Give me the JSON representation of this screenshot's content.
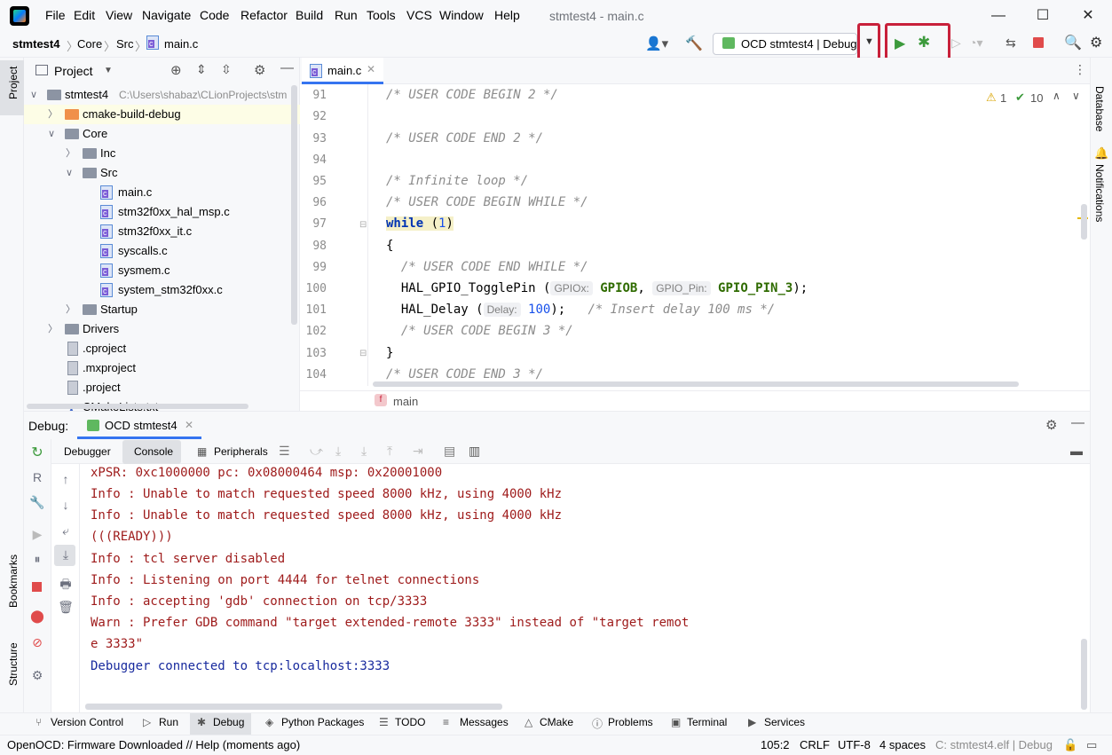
{
  "menu": [
    "File",
    "Edit",
    "View",
    "Navigate",
    "Code",
    "Refactor",
    "Build",
    "Run",
    "Tools",
    "VCS",
    "Window",
    "Help"
  ],
  "window_title": "stmtest4 - main.c",
  "window_buttons": {
    "minimize": "—",
    "maximize": "☐",
    "close": "✕"
  },
  "breadcrumb": [
    "stmtest4",
    "Core",
    "Src",
    "main.c"
  ],
  "run_config": "OCD stmtest4 | Debug",
  "project": {
    "title": "Project",
    "root_name": "stmtest4",
    "root_path": "C:\\Users\\shabaz\\CLionProjects\\stm",
    "items": [
      "cmake-build-debug",
      "Core",
      "Inc",
      "Src",
      "main.c",
      "stm32f0xx_hal_msp.c",
      "stm32f0xx_it.c",
      "syscalls.c",
      "sysmem.c",
      "system_stm32f0xx.c",
      "Startup",
      "Drivers",
      ".cproject",
      ".mxproject",
      ".project",
      "CMakeLists.txt"
    ]
  },
  "editor": {
    "tab": "main.c",
    "warnings": "1",
    "checks": "10",
    "line_numbers": [
      "91",
      "92",
      "93",
      "94",
      "95",
      "96",
      "97",
      "98",
      "99",
      "100",
      "101",
      "102",
      "103",
      "104"
    ],
    "lines": {
      "l91": "/* USER CODE BEGIN 2 */",
      "l93": "/* USER CODE END 2 */",
      "l95": "/* Infinite loop */",
      "l96": "/* USER CODE BEGIN WHILE */",
      "l97_kw": "while",
      "l97_rest": " (",
      "l97_num": "1",
      "l97_end": ")",
      "l98": "{",
      "l99": "  /* USER CODE END WHILE */",
      "l100_fn": "  HAL_GPIO_TogglePin (",
      "l100_hint1": "GPIOx:",
      "l100_arg1": "GPIOB",
      "l100_comma": ", ",
      "l100_hint2": "GPIO_Pin:",
      "l100_arg2": "GPIO_PIN_3",
      "l100_end": ");",
      "l101_fn": "  HAL_Delay (",
      "l101_hint": "Delay:",
      "l101_num": "100",
      "l101_end": ");   ",
      "l101_cm": "/* Insert delay 100 ms */",
      "l102": "  /* USER CODE BEGIN 3 */",
      "l103": "}",
      "l104": "/* USER CODE END 3 */"
    },
    "crumb": "main"
  },
  "debug": {
    "label": "Debug:",
    "session": "OCD stmtest4",
    "tabs": [
      "Debugger",
      "Console",
      "Peripherals"
    ],
    "console_lines": [
      "xPSR: 0xc1000000 pc: 0x08000464 msp: 0x20001000",
      "Info : Unable to match requested speed 8000 kHz, using 4000 kHz",
      "Info : Unable to match requested speed 8000 kHz, using 4000 kHz",
      "(((READY)))",
      "Info : tcl server disabled",
      "Info : Listening on port 4444 for telnet connections",
      "Info : accepting 'gdb' connection on tcp/3333",
      "Warn : Prefer GDB command \"target extended-remote 3333\" instead of \"target remot",
      "e 3333\""
    ],
    "console_last": "Debugger connected to tcp:localhost:3333"
  },
  "side_labels": {
    "project": "Project",
    "bookmarks": "Bookmarks",
    "structure": "Structure",
    "database": "Database",
    "notifications": "Notifications"
  },
  "bottom_tabs": [
    "Version Control",
    "Run",
    "Debug",
    "Python Packages",
    "TODO",
    "Messages",
    "CMake",
    "Problems",
    "Terminal",
    "Services"
  ],
  "status": {
    "message": "OpenOCD: Firmware Downloaded // Help (moments ago)",
    "position": "105:2",
    "line_sep": "CRLF",
    "encoding": "UTF-8",
    "indent": "4 spaces",
    "context": "C: stmtest4.elf | Debug"
  }
}
